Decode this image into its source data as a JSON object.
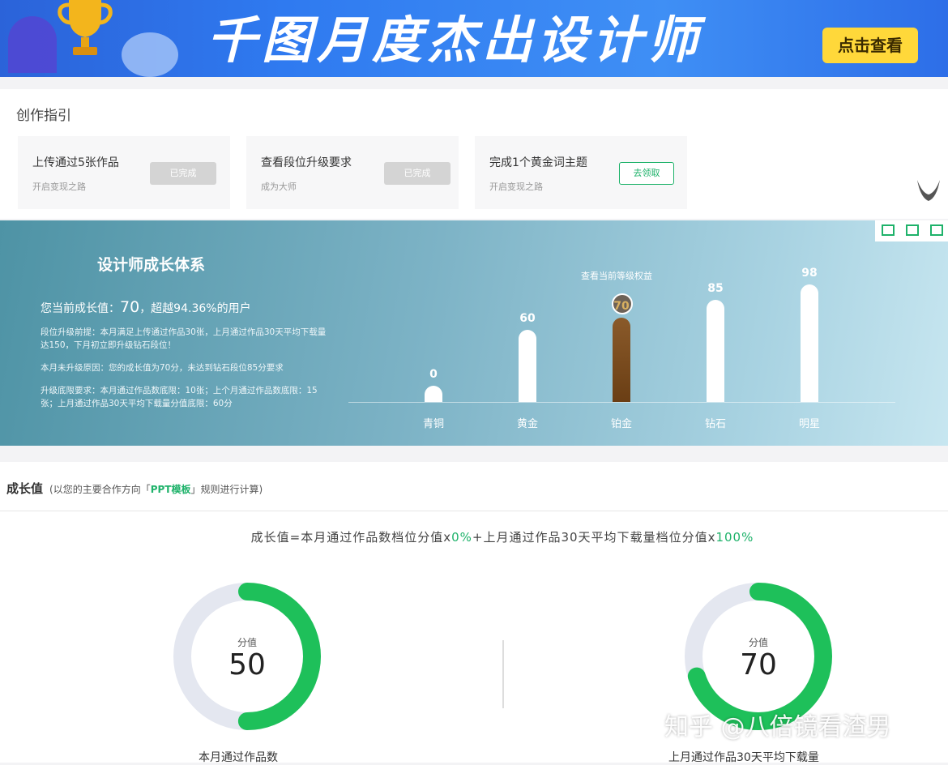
{
  "banner": {
    "title": "千图月度杰出设计师",
    "cta": "点击查看"
  },
  "guide": {
    "heading": "创作指引",
    "cards": [
      {
        "title": "上传通过5张作品",
        "sub": "开启变现之路",
        "button": "已完成",
        "state": "done"
      },
      {
        "title": "查看段位升级要求",
        "sub": "成为大师",
        "button": "已完成",
        "state": "done"
      },
      {
        "title": "完成1个黄金词主题",
        "sub": "开启变现之路",
        "button": "去领取",
        "state": "go"
      }
    ]
  },
  "growth": {
    "title": "设计师成长体系",
    "current_prefix": "您当前成长值：",
    "current_value": "70",
    "current_suffix": "，超越94.36%的用户",
    "p1": "段位升级前提：本月满足上传通过作品30张，上月通过作品30天平均下载量达150，下月初立即升级钻石段位！",
    "p2": "本月未升级原因：您的成长值为70分，未达到钻石段位85分要求",
    "p3": "升级底限要求：本月通过作品数底限：10张；上个月通过作品数底限：15张；上月通过作品30天平均下载量分值底限：60分",
    "rights_link": "查看当前等级权益",
    "levels": [
      {
        "name": "青铜",
        "value": 0
      },
      {
        "name": "黄金",
        "value": 60
      },
      {
        "name": "铂金",
        "value": 70,
        "current": true
      },
      {
        "name": "钻石",
        "value": 85
      },
      {
        "name": "明星",
        "value": 98
      }
    ]
  },
  "score": {
    "head": "成长值",
    "note_pre": "(以您的主要合作方向「",
    "note_em": "PPT模板",
    "note_post": "」规则进行计算)",
    "formula_a": "成长值=本月通过作品数档位分值x",
    "formula_a_pct": "0%",
    "formula_b": "+上月通过作品30天平均下载量档位分值x",
    "formula_b_pct": "100%",
    "donut_label": "分值",
    "left": {
      "value": "50",
      "fraction": 0.5,
      "caption": "本月通过作品数"
    },
    "right": {
      "value": "70",
      "fraction": 0.7,
      "caption": "上月通过作品30天平均下载量"
    }
  },
  "watermark": "知乎 @八倍镜看渣男",
  "colors": {
    "green": "#1eb26a",
    "ring_bg": "#e4e7f0",
    "banner": "#2f7af0",
    "cta": "#ffd83a"
  }
}
